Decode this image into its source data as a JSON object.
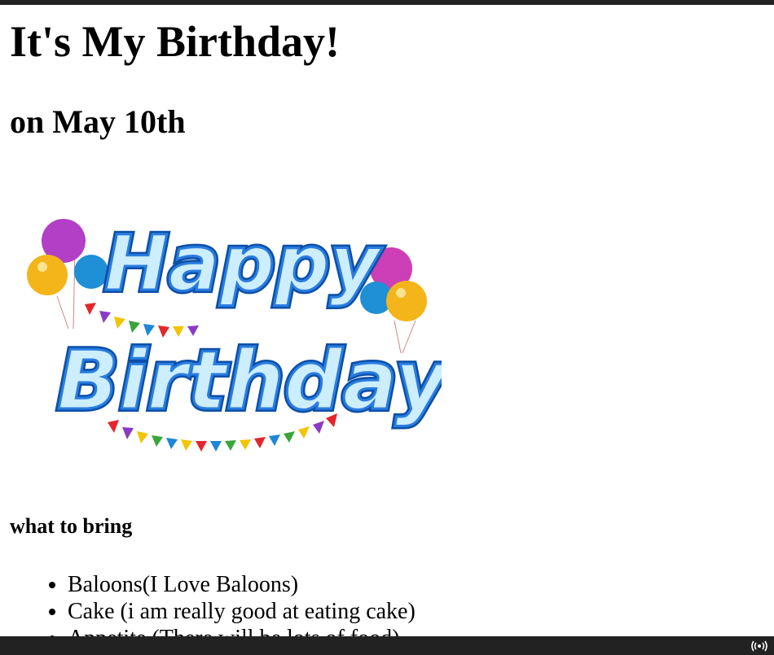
{
  "page": {
    "title": "It's My Birthday!",
    "subtitle": "on May 10th",
    "section_heading": "what to bring",
    "items": [
      "Baloons(I Love Baloons)",
      "Cake (i am really good at eating cake)",
      "Appetite (There will be lots of food)"
    ]
  },
  "image": {
    "line1": "Happy",
    "line2": "Birthday",
    "icon": "happy-birthday-banner"
  },
  "footer": {
    "icon": "broadcast-icon"
  },
  "colors": {
    "text_main": "#2a7de0",
    "text_light": "#cdeeff",
    "text_shadow": "#0c4fa8",
    "bars": "#222222"
  }
}
